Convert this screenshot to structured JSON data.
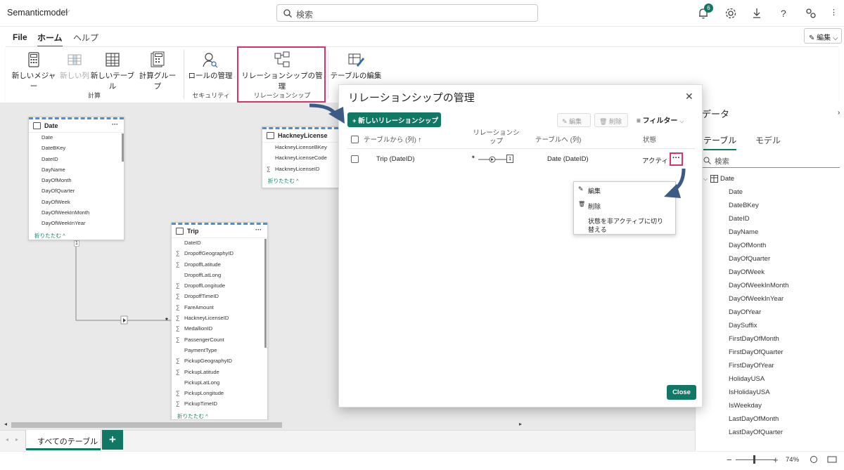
{
  "app": {
    "title": "Semanticmodel"
  },
  "search": {
    "placeholder": "検索"
  },
  "notifications": {
    "count": "6"
  },
  "menu": {
    "file": "File",
    "home": "ホーム",
    "help": "ヘルプ",
    "edit": "編集"
  },
  "ribbon": {
    "new_measure": "新しいメジャー",
    "new_column": "新しい列",
    "new_table": "新しいテーブル",
    "calc_group": "計算グループ",
    "group_calc": "計算",
    "manage_roles": "ロールの管理",
    "group_security": "セキュリティ",
    "manage_relationships": "リレーションシップの管理",
    "group_relationships": "リレーションシップ",
    "edit_tables": "テーブルの編集"
  },
  "tables": {
    "date": {
      "name": "Date",
      "fields": [
        "Date",
        "DateBKey",
        "DateID",
        "DayName",
        "DayOfMonth",
        "DayOfQuarter",
        "DayOfWeek",
        "DayOfWeekInMonth",
        "DayOfWeekInYear"
      ],
      "collapse": "折りたたむ ^"
    },
    "hackney": {
      "name": "HackneyLicense",
      "fields": [
        "HackneyLicenseBKey",
        "HackneyLicenseCode",
        "HackneyLicenseID"
      ],
      "sigma": [
        false,
        false,
        true
      ],
      "collapse": "折りたたむ ^"
    },
    "trip": {
      "name": "Trip",
      "fields": [
        "DateID",
        "DropoffGeographyID",
        "DropoffLatitude",
        "DropoffLatLong",
        "DropoffLongitude",
        "DropoffTimeID",
        "FareAmount",
        "HackneyLicenseID",
        "MedallionID",
        "PassengerCount",
        "PaymentType",
        "PickupGeographyID",
        "PickupLatitude",
        "PickupLatLong",
        "PickupLongitude",
        "PickupTimeID"
      ],
      "sigma": [
        false,
        true,
        true,
        false,
        true,
        true,
        true,
        true,
        true,
        true,
        false,
        true,
        true,
        false,
        true,
        true
      ],
      "collapse": "折りたたむ ^"
    },
    "rel_one": "1",
    "rel_many": "*"
  },
  "tabs": {
    "all_tables": "すべてのテーブル",
    "add": "+"
  },
  "status": {
    "zoom": "74%"
  },
  "data_pane": {
    "title": "データ",
    "tab_tables": "テーブル",
    "tab_model": "モデル",
    "search_placeholder": "検索",
    "table": "Date",
    "fields": [
      "Date",
      "DateBKey",
      "DateID",
      "DayName",
      "DayOfMonth",
      "DayOfQuarter",
      "DayOfWeek",
      "DayOfWeekInMonth",
      "DayOfWeekInYear",
      "DayOfYear",
      "DaySuffix",
      "FirstDayOfMonth",
      "FirstDayOfQuarter",
      "FirstDayOfYear",
      "HolidayUSA",
      "IsHolidayUSA",
      "IsWeekday",
      "LastDayOfMonth",
      "LastDayOfQuarter"
    ]
  },
  "dialog": {
    "title": "リレーションシップの管理",
    "new_button": "新しいリレーションシップ",
    "edit": "編集",
    "delete": "削除",
    "filter": "フィルター",
    "col_from": "テーブルから (列)",
    "col_rel": "リレーションシップ",
    "col_to": "テーブルへ (列)",
    "col_state": "状態",
    "row": {
      "from": "Trip (DateID)",
      "card_many": "*",
      "card_one": "1",
      "to": "Date (DateID)",
      "state": "アクティ"
    },
    "context_menu": {
      "edit": "編集",
      "delete": "削除",
      "toggle": "状態を非アクティブに切り替える"
    },
    "close": "Close"
  },
  "colors": {
    "accent": "#117865",
    "highlight": "#d6336c",
    "arrow": "#3b5a86"
  }
}
